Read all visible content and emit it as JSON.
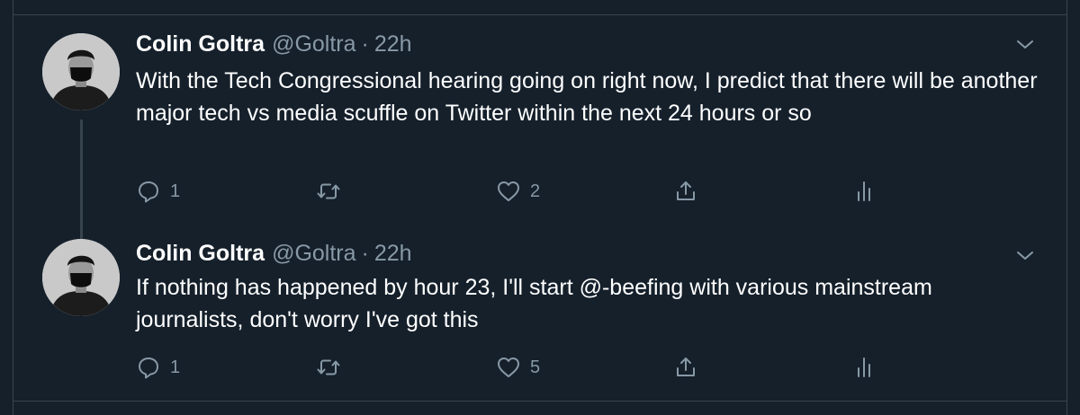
{
  "tweets": [
    {
      "name": "Colin Goltra",
      "handle": "@Goltra",
      "separator": "·",
      "time": "22h",
      "text": "With the Tech Congressional hearing going on right now, I predict that there will be another major tech vs media scuffle on Twitter within the next 24 hours or so",
      "reply_count": "1",
      "retweet_count": "",
      "like_count": "2"
    },
    {
      "name": "Colin Goltra",
      "handle": "@Goltra",
      "separator": "·",
      "time": "22h",
      "text": "If nothing has happened by hour 23, I'll start @-beefing with various mainstream journalists, don't worry I've got this",
      "reply_count": "1",
      "retweet_count": "",
      "like_count": "5"
    }
  ],
  "icons": {
    "reply": "reply-icon",
    "retweet": "retweet-icon",
    "like": "heart-icon",
    "share": "share-icon",
    "analytics": "analytics-icon",
    "more": "chevron-down-icon"
  },
  "colors": {
    "background": "#15202b",
    "border": "#38444d",
    "secondary_text": "#8899a6",
    "primary_text": "#ffffff"
  }
}
